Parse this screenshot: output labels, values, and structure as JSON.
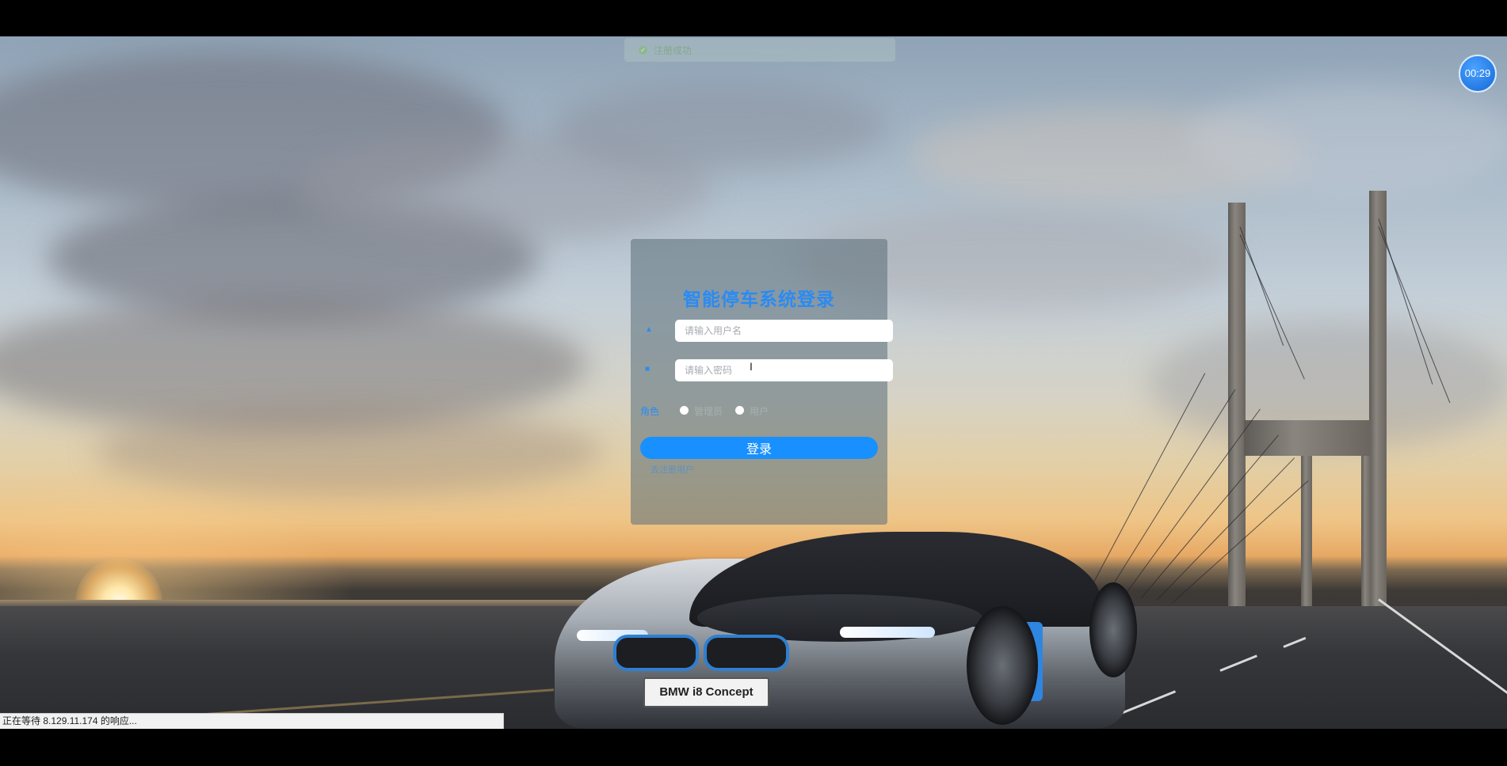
{
  "toast": {
    "text": "注册成功",
    "icon": "check-circle-icon"
  },
  "timer": {
    "text": "00:29"
  },
  "login": {
    "title": "智能停车系统登录",
    "username_placeholder": "请输入用户名",
    "password_placeholder": "请输入密码",
    "role_label": "角色",
    "role_options": [
      "管理员",
      "用户"
    ],
    "submit_label": "登录",
    "register_link": "去注册用户"
  },
  "car": {
    "plate_text": "BMW i8 Concept"
  },
  "status_bar": {
    "text": "正在等待 8.129.11.174 的响应..."
  },
  "colors": {
    "accent": "#1890ff",
    "title": "#2a8bf2"
  }
}
